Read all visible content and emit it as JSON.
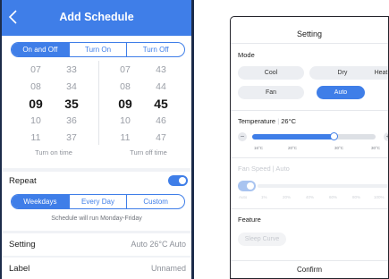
{
  "schedule": {
    "title": "Add Schedule",
    "mode_tabs": [
      {
        "label": "On and Off",
        "active": true
      },
      {
        "label": "Turn On",
        "active": false
      },
      {
        "label": "Turn Off",
        "active": false
      }
    ],
    "on_hours": [
      "07",
      "08",
      "09",
      "10",
      "11"
    ],
    "on_minutes": [
      "33",
      "34",
      "35",
      "36",
      "37"
    ],
    "off_hours": [
      "07",
      "08",
      "09",
      "10",
      "11"
    ],
    "off_minutes": [
      "43",
      "44",
      "45",
      "46",
      "47"
    ],
    "on_caption": "Turn on time",
    "off_caption": "Turn off time",
    "repeat_label": "Repeat",
    "repeat_enabled": true,
    "repeat_tabs": [
      {
        "label": "Weekdays",
        "active": true
      },
      {
        "label": "Every Day",
        "active": false
      },
      {
        "label": "Custom",
        "active": false
      }
    ],
    "repeat_hint": "Schedule will run Monday-Friday",
    "setting_label": "Setting",
    "setting_value": "Auto 26°C Auto",
    "label_label": "Label",
    "label_value": "Unnamed"
  },
  "setting": {
    "title": "Setting",
    "mode_label": "Mode",
    "modes": [
      {
        "label": "Cool",
        "active": false
      },
      {
        "label": "Dry",
        "active": false
      },
      {
        "label": "Heat",
        "active": false
      },
      {
        "label": "Fan",
        "active": false
      },
      {
        "label": "Auto",
        "active": true
      }
    ],
    "temperature_label": "Temperature",
    "temperature_value": "26°C",
    "temp_minus": "−",
    "temp_plus": "+",
    "temp_ticks": [
      "16°C",
      "20°C",
      "30°C",
      "30°C"
    ],
    "temp_fraction": 0.66,
    "fan_label": "Fan Speed",
    "fan_value": "Auto",
    "fan_ticks": [
      "Auto",
      "1%",
      "20%",
      "40%",
      "60%",
      "80%",
      "100%"
    ],
    "feature_label": "Feature",
    "feature_button": "Sleep Curve",
    "confirm_label": "Confirm"
  }
}
